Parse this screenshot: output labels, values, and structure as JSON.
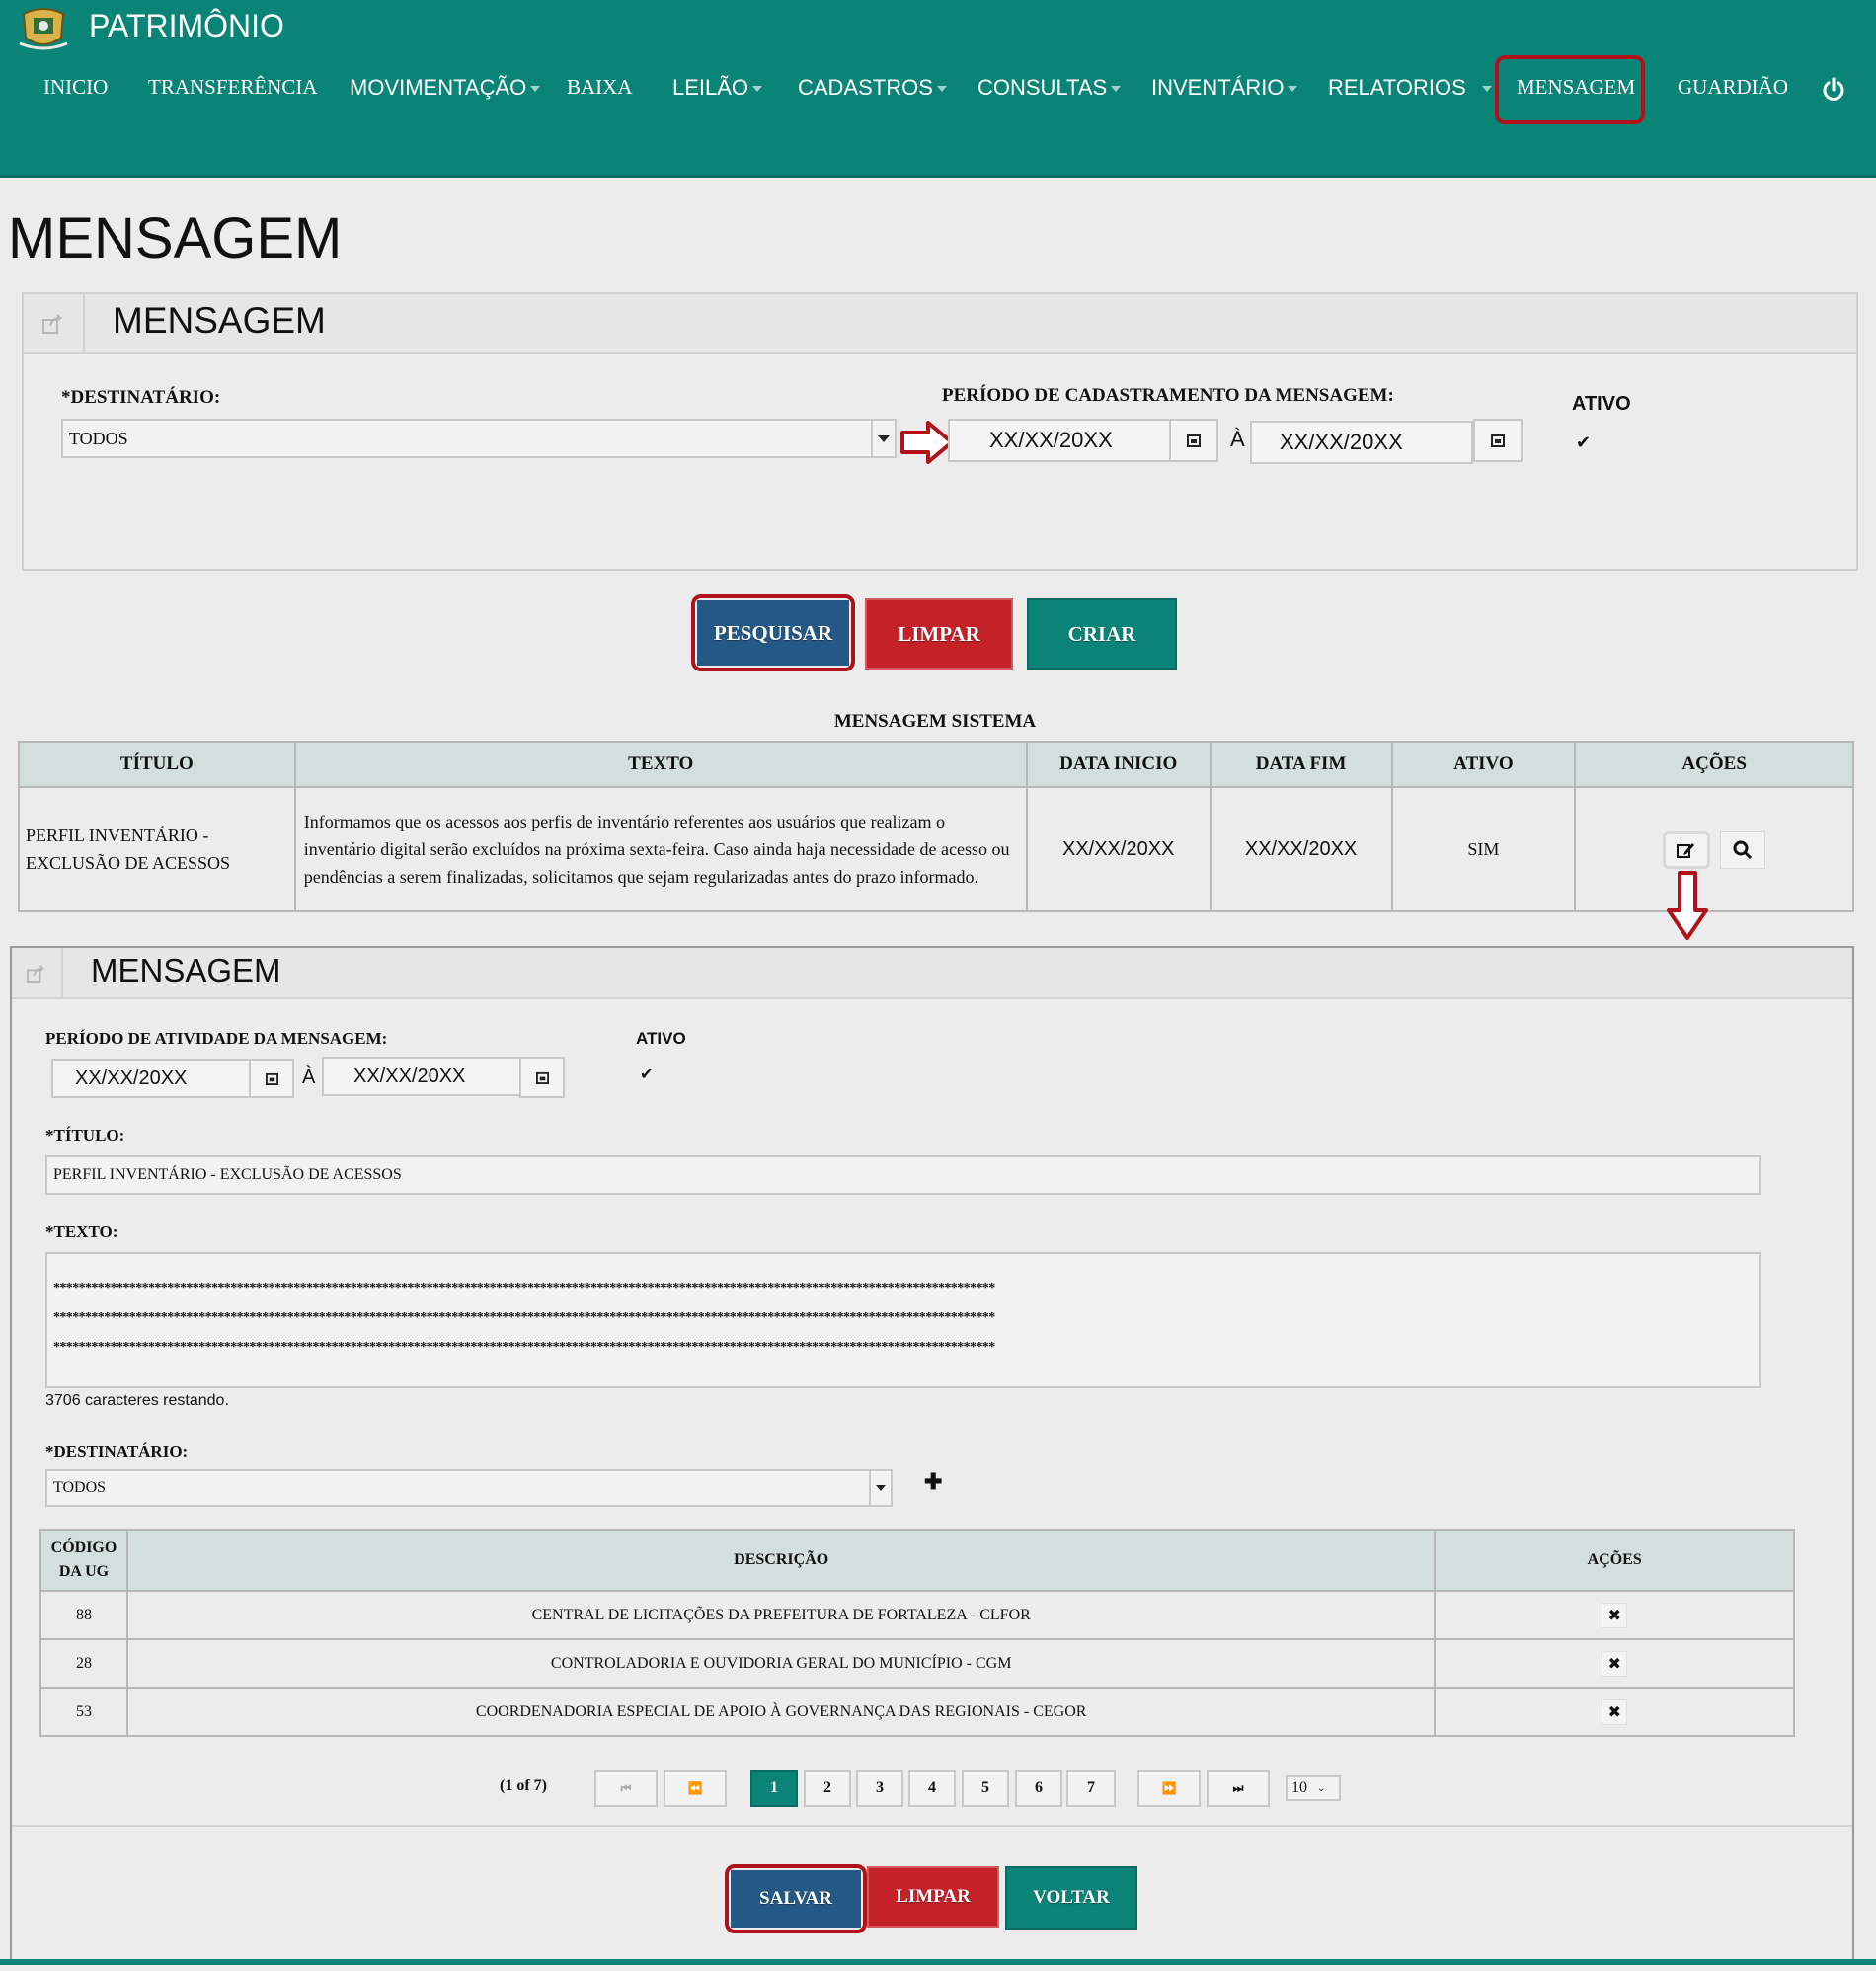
{
  "app": {
    "title": "PATRIMÔNIO"
  },
  "nav": {
    "items": [
      {
        "label": "INICIO"
      },
      {
        "label": "TRANSFERÊNCIA"
      },
      {
        "label": "MOVIMENTAÇÃO"
      },
      {
        "label": "BAIXA"
      },
      {
        "label": "LEILÃO"
      },
      {
        "label": "CADASTROS"
      },
      {
        "label": "CONSULTAS"
      },
      {
        "label": "INVENTÁRIO"
      },
      {
        "label": "RELATORIOS"
      },
      {
        "label": "MENSAGEM"
      },
      {
        "label": "GUARDIÃO"
      }
    ],
    "power_icon": "power-icon"
  },
  "page": {
    "heading": "MENSAGEM"
  },
  "search_panel": {
    "title": "MENSAGEM",
    "destinatario_label": "*DESTINATÁRIO:",
    "destinatario_value": "TODOS",
    "periodo_label": "PERÍODO DE CADASTRAMENTO DA MENSAGEM:",
    "date_from": "XX/XX/20XX",
    "date_sep": "À",
    "date_to": "XX/XX/20XX",
    "ativo_label": "ATIVO",
    "ativo_check": "✔"
  },
  "search_buttons": {
    "pesquisar": "PESQUISAR",
    "limpar": "LIMPAR",
    "criar": "CRIAR"
  },
  "results": {
    "caption": "MENSAGEM SISTEMA",
    "headers": [
      "TÍTULO",
      "TEXTO",
      "DATA INICIO",
      "DATA FIM",
      "ATIVO",
      "AÇÕES"
    ],
    "row": {
      "titulo": "PERFIL INVENTÁRIO - EXCLUSÃO DE ACESSOS",
      "texto": "Informamos que os acessos aos perfis de inventário referentes aos usuários que realizam o inventário digital serão excluídos na próxima sexta-feira.  Caso ainda haja necessidade de acesso ou pendências a serem finalizadas, solicitamos que sejam regularizadas antes do prazo informado.",
      "data_inicio": "XX/XX/20XX",
      "data_fim": "XX/XX/20XX",
      "ativo": "SIM"
    }
  },
  "edit_panel": {
    "title": "MENSAGEM",
    "periodo_label": "PERÍODO DE ATIVIDADE DA MENSAGEM:",
    "date_from": "XX/XX/20XX",
    "date_sep": "À",
    "date_to": "XX/XX/20XX",
    "ativo_label": "ATIVO",
    "ativo_check": "✔",
    "titulo_label": "*TÍTULO:",
    "titulo_value": "PERFIL INVENTÁRIO - EXCLUSÃO DE ACESSOS",
    "texto_label": "*TEXTO:",
    "texto_lines": [
      "*****************************************************************************************************************************************************",
      "*****************************************************************************************************************************************************",
      "*****************************************************************************************************************************************************"
    ],
    "chars_remaining": "3706 caracteres restando.",
    "destinatario_label": "*DESTINATÁRIO:",
    "destinatario_value": "TODOS",
    "add_symbol": "✚"
  },
  "ug_table": {
    "headers": [
      "CÓDIGO DA UG",
      "DESCRIÇÃO",
      "AÇÕES"
    ],
    "rows": [
      {
        "codigo": "88",
        "descricao": "CENTRAL DE LICITAÇÕES DA PREFEITURA DE FORTALEZA - CLFOR"
      },
      {
        "codigo": "28",
        "descricao": "CONTROLADORIA E OUVIDORIA GERAL DO MUNICÍPIO - CGM"
      },
      {
        "codigo": "53",
        "descricao": "COORDENADORIA ESPECIAL DE APOIO À GOVERNANÇA DAS REGIONAIS - CEGOR"
      }
    ],
    "remove_symbol": "✖"
  },
  "pagination": {
    "summary": "(1 of 7)",
    "first": "⏮",
    "prev": "⏪",
    "pages": [
      "1",
      "2",
      "3",
      "4",
      "5",
      "6",
      "7"
    ],
    "current": "1",
    "next": "⏩",
    "last": "⏭",
    "per_page": "10"
  },
  "edit_buttons": {
    "salvar": "SALVAR",
    "limpar": "LIMPAR",
    "voltar": "VOLTAR"
  },
  "colors": {
    "header": "#0b8478",
    "blue_button": "#245885",
    "red_button": "#c42128",
    "highlight": "#b0121b"
  }
}
